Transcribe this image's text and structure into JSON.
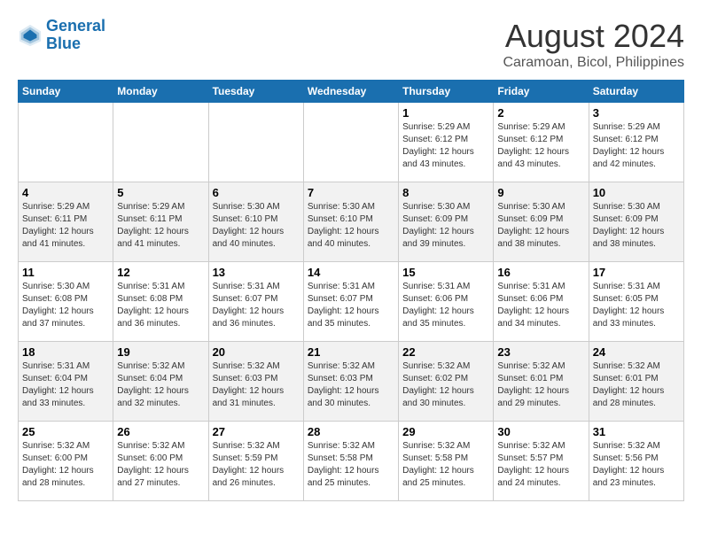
{
  "header": {
    "logo_line1": "General",
    "logo_line2": "Blue",
    "main_title": "August 2024",
    "subtitle": "Caramoan, Bicol, Philippines"
  },
  "calendar": {
    "days_of_week": [
      "Sunday",
      "Monday",
      "Tuesday",
      "Wednesday",
      "Thursday",
      "Friday",
      "Saturday"
    ],
    "weeks": [
      [
        {
          "day": "",
          "info": ""
        },
        {
          "day": "",
          "info": ""
        },
        {
          "day": "",
          "info": ""
        },
        {
          "day": "",
          "info": ""
        },
        {
          "day": "1",
          "info": "Sunrise: 5:29 AM\nSunset: 6:12 PM\nDaylight: 12 hours\nand 43 minutes."
        },
        {
          "day": "2",
          "info": "Sunrise: 5:29 AM\nSunset: 6:12 PM\nDaylight: 12 hours\nand 43 minutes."
        },
        {
          "day": "3",
          "info": "Sunrise: 5:29 AM\nSunset: 6:12 PM\nDaylight: 12 hours\nand 42 minutes."
        }
      ],
      [
        {
          "day": "4",
          "info": "Sunrise: 5:29 AM\nSunset: 6:11 PM\nDaylight: 12 hours\nand 41 minutes."
        },
        {
          "day": "5",
          "info": "Sunrise: 5:29 AM\nSunset: 6:11 PM\nDaylight: 12 hours\nand 41 minutes."
        },
        {
          "day": "6",
          "info": "Sunrise: 5:30 AM\nSunset: 6:10 PM\nDaylight: 12 hours\nand 40 minutes."
        },
        {
          "day": "7",
          "info": "Sunrise: 5:30 AM\nSunset: 6:10 PM\nDaylight: 12 hours\nand 40 minutes."
        },
        {
          "day": "8",
          "info": "Sunrise: 5:30 AM\nSunset: 6:09 PM\nDaylight: 12 hours\nand 39 minutes."
        },
        {
          "day": "9",
          "info": "Sunrise: 5:30 AM\nSunset: 6:09 PM\nDaylight: 12 hours\nand 38 minutes."
        },
        {
          "day": "10",
          "info": "Sunrise: 5:30 AM\nSunset: 6:09 PM\nDaylight: 12 hours\nand 38 minutes."
        }
      ],
      [
        {
          "day": "11",
          "info": "Sunrise: 5:30 AM\nSunset: 6:08 PM\nDaylight: 12 hours\nand 37 minutes."
        },
        {
          "day": "12",
          "info": "Sunrise: 5:31 AM\nSunset: 6:08 PM\nDaylight: 12 hours\nand 36 minutes."
        },
        {
          "day": "13",
          "info": "Sunrise: 5:31 AM\nSunset: 6:07 PM\nDaylight: 12 hours\nand 36 minutes."
        },
        {
          "day": "14",
          "info": "Sunrise: 5:31 AM\nSunset: 6:07 PM\nDaylight: 12 hours\nand 35 minutes."
        },
        {
          "day": "15",
          "info": "Sunrise: 5:31 AM\nSunset: 6:06 PM\nDaylight: 12 hours\nand 35 minutes."
        },
        {
          "day": "16",
          "info": "Sunrise: 5:31 AM\nSunset: 6:06 PM\nDaylight: 12 hours\nand 34 minutes."
        },
        {
          "day": "17",
          "info": "Sunrise: 5:31 AM\nSunset: 6:05 PM\nDaylight: 12 hours\nand 33 minutes."
        }
      ],
      [
        {
          "day": "18",
          "info": "Sunrise: 5:31 AM\nSunset: 6:04 PM\nDaylight: 12 hours\nand 33 minutes."
        },
        {
          "day": "19",
          "info": "Sunrise: 5:32 AM\nSunset: 6:04 PM\nDaylight: 12 hours\nand 32 minutes."
        },
        {
          "day": "20",
          "info": "Sunrise: 5:32 AM\nSunset: 6:03 PM\nDaylight: 12 hours\nand 31 minutes."
        },
        {
          "day": "21",
          "info": "Sunrise: 5:32 AM\nSunset: 6:03 PM\nDaylight: 12 hours\nand 30 minutes."
        },
        {
          "day": "22",
          "info": "Sunrise: 5:32 AM\nSunset: 6:02 PM\nDaylight: 12 hours\nand 30 minutes."
        },
        {
          "day": "23",
          "info": "Sunrise: 5:32 AM\nSunset: 6:01 PM\nDaylight: 12 hours\nand 29 minutes."
        },
        {
          "day": "24",
          "info": "Sunrise: 5:32 AM\nSunset: 6:01 PM\nDaylight: 12 hours\nand 28 minutes."
        }
      ],
      [
        {
          "day": "25",
          "info": "Sunrise: 5:32 AM\nSunset: 6:00 PM\nDaylight: 12 hours\nand 28 minutes."
        },
        {
          "day": "26",
          "info": "Sunrise: 5:32 AM\nSunset: 6:00 PM\nDaylight: 12 hours\nand 27 minutes."
        },
        {
          "day": "27",
          "info": "Sunrise: 5:32 AM\nSunset: 5:59 PM\nDaylight: 12 hours\nand 26 minutes."
        },
        {
          "day": "28",
          "info": "Sunrise: 5:32 AM\nSunset: 5:58 PM\nDaylight: 12 hours\nand 25 minutes."
        },
        {
          "day": "29",
          "info": "Sunrise: 5:32 AM\nSunset: 5:58 PM\nDaylight: 12 hours\nand 25 minutes."
        },
        {
          "day": "30",
          "info": "Sunrise: 5:32 AM\nSunset: 5:57 PM\nDaylight: 12 hours\nand 24 minutes."
        },
        {
          "day": "31",
          "info": "Sunrise: 5:32 AM\nSunset: 5:56 PM\nDaylight: 12 hours\nand 23 minutes."
        }
      ]
    ]
  }
}
